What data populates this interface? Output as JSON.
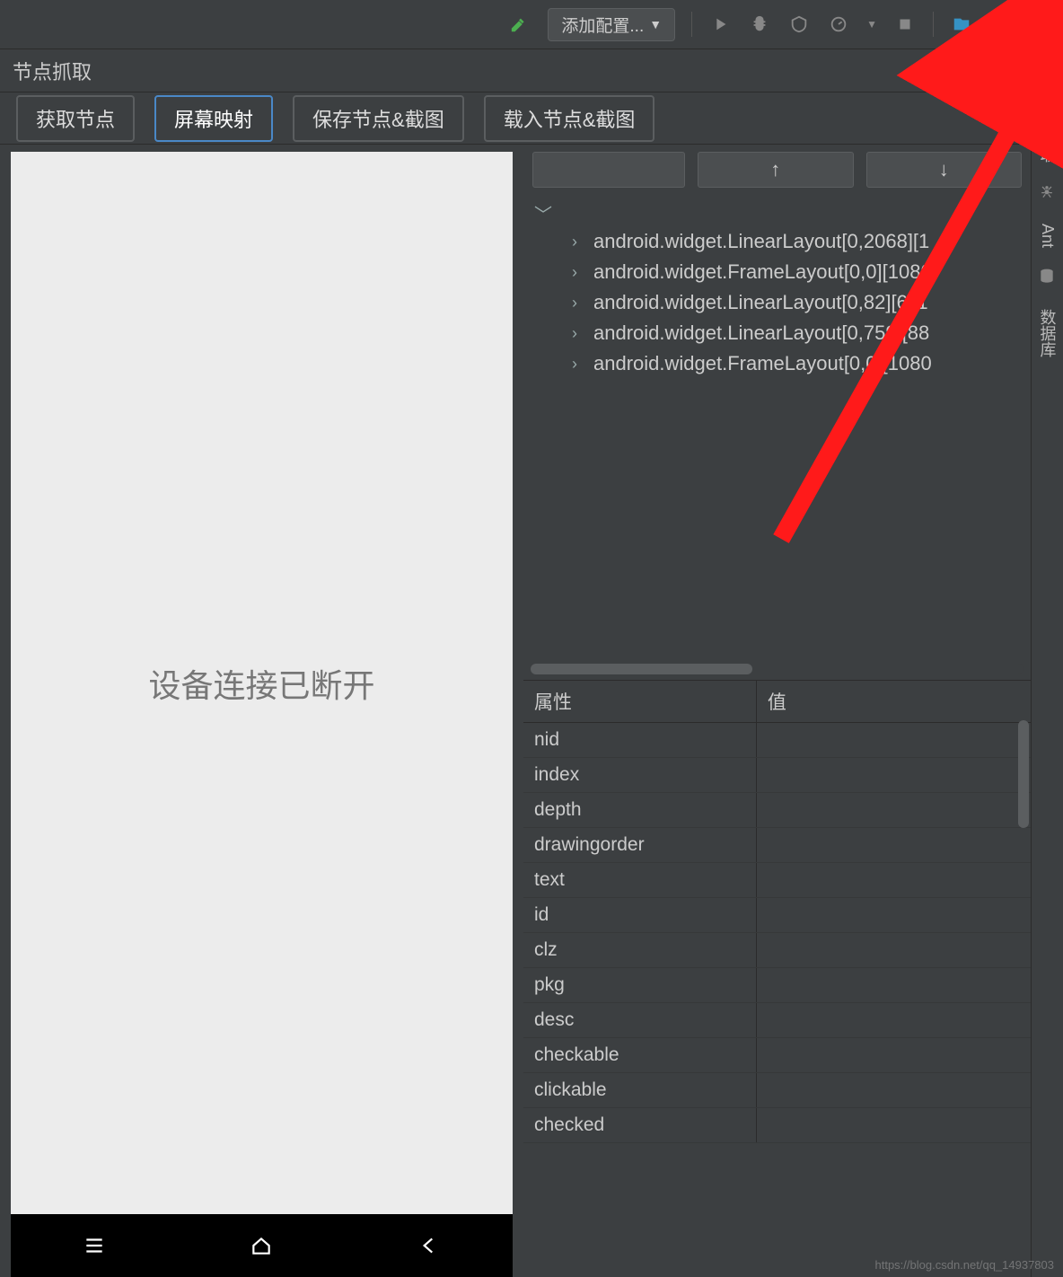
{
  "toolbar": {
    "config_label": "添加配置..."
  },
  "panel": {
    "title": "节点抓取"
  },
  "actions": {
    "fetch": "获取节点",
    "mirror": "屏幕映射",
    "save": "保存节点&截图",
    "load": "载入节点&截图"
  },
  "device": {
    "preview_text": "设备连接已断开"
  },
  "nav": {
    "blank": "",
    "up": "↑",
    "down": "↓"
  },
  "tree": {
    "items": [
      "android.widget.LinearLayout[0,2068][1",
      "android.widget.FrameLayout[0,0][1080",
      "android.widget.LinearLayout[0,82][611",
      "android.widget.LinearLayout[0,759][88",
      "android.widget.FrameLayout[0,0][1080"
    ]
  },
  "props": {
    "header_attr": "属性",
    "header_val": "值",
    "rows": [
      "nid",
      "index",
      "depth",
      "drawingorder",
      "text",
      "id",
      "clz",
      "pkg",
      "desc",
      "checkable",
      "clickable",
      "checked"
    ]
  },
  "sidebar": {
    "tabs": [
      "节点抓取",
      "Ant",
      "数据库"
    ]
  },
  "watermark": "https://blog.csdn.net/qq_14937803"
}
